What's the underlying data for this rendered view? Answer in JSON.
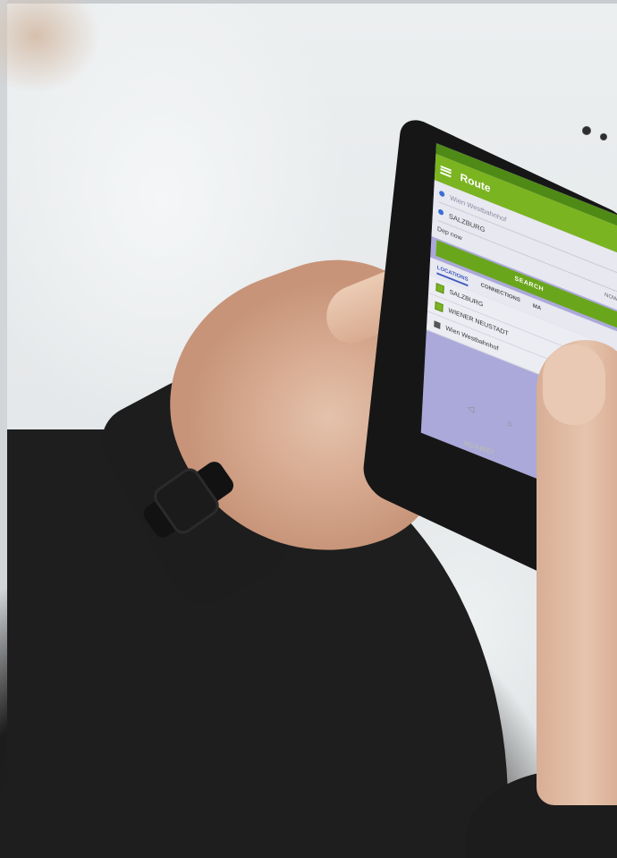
{
  "photo": {
    "description_free": true
  },
  "app": {
    "status_text": "",
    "title": "Route",
    "from_field": "Wien Westbahnhof",
    "to_field": "SALZBURG",
    "departure_label": "Dep",
    "departure_value": "now",
    "now_button": "NOW",
    "search_button": "SEARCH",
    "tabs": [
      {
        "label": "LOCATIONS"
      },
      {
        "label": "CONNECTIONS"
      },
      {
        "label": "MA"
      }
    ],
    "locations": [
      {
        "label": "SALZBURG"
      },
      {
        "label": "WIENER NEUSTADT"
      },
      {
        "label": "Wien Westbahnhof"
      }
    ],
    "nav_back": "◁",
    "nav_home": "○",
    "nav_recent": "□"
  },
  "phone": {
    "brand": "HUAWEI"
  },
  "colors": {
    "app_green": "#7bb421",
    "app_dark_green": "#4f8a16",
    "accent_blue": "#3f5ac0"
  }
}
